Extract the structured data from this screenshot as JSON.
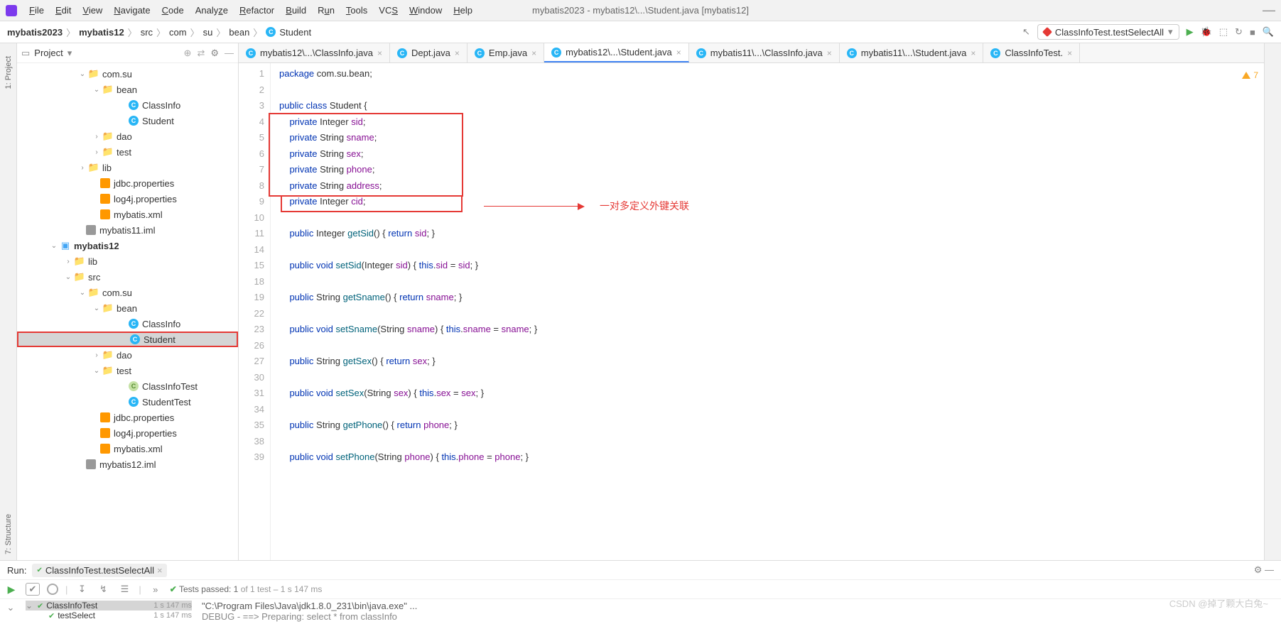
{
  "window_title": "mybatis2023 - mybatis12\\...\\Student.java [mybatis12]",
  "menu": [
    "File",
    "Edit",
    "View",
    "Navigate",
    "Code",
    "Analyze",
    "Refactor",
    "Build",
    "Run",
    "Tools",
    "VCS",
    "Window",
    "Help"
  ],
  "breadcrumb": [
    "mybatis2023",
    "mybatis12",
    "src",
    "com",
    "su",
    "bean",
    "Student"
  ],
  "run_config": "ClassInfoTest.testSelectAll",
  "project_label": "Project",
  "tree": [
    {
      "indent": 84,
      "arrow": "v",
      "icon": "folder",
      "label": "com.su"
    },
    {
      "indent": 104,
      "arrow": "v",
      "icon": "folder",
      "label": "bean"
    },
    {
      "indent": 140,
      "arrow": "",
      "icon": "c",
      "label": "ClassInfo"
    },
    {
      "indent": 140,
      "arrow": "",
      "icon": "c",
      "label": "Student"
    },
    {
      "indent": 104,
      "arrow": ">",
      "icon": "folder",
      "label": "dao"
    },
    {
      "indent": 104,
      "arrow": ">",
      "icon": "folder",
      "label": "test"
    },
    {
      "indent": 84,
      "arrow": ">",
      "icon": "folder",
      "label": "lib"
    },
    {
      "indent": 100,
      "arrow": "",
      "icon": "orange",
      "label": "jdbc.properties"
    },
    {
      "indent": 100,
      "arrow": "",
      "icon": "orange",
      "label": "log4j.properties"
    },
    {
      "indent": 100,
      "arrow": "",
      "icon": "orange",
      "label": "mybatis.xml"
    },
    {
      "indent": 80,
      "arrow": "",
      "icon": "gray",
      "label": "mybatis11.iml"
    },
    {
      "indent": 44,
      "arrow": "v",
      "icon": "module",
      "label": "mybatis12",
      "bold": true
    },
    {
      "indent": 64,
      "arrow": ">",
      "icon": "folder",
      "label": "lib"
    },
    {
      "indent": 64,
      "arrow": "v",
      "icon": "folder-blue",
      "label": "src"
    },
    {
      "indent": 84,
      "arrow": "v",
      "icon": "folder",
      "label": "com.su"
    },
    {
      "indent": 104,
      "arrow": "v",
      "icon": "folder",
      "label": "bean"
    },
    {
      "indent": 140,
      "arrow": "",
      "icon": "c",
      "label": "ClassInfo"
    },
    {
      "indent": 140,
      "arrow": "",
      "icon": "c",
      "label": "Student",
      "sel": true,
      "redbox": true
    },
    {
      "indent": 104,
      "arrow": ">",
      "icon": "folder",
      "label": "dao"
    },
    {
      "indent": 104,
      "arrow": "v",
      "icon": "folder",
      "label": "test"
    },
    {
      "indent": 140,
      "arrow": "",
      "icon": "cg",
      "label": "ClassInfoTest"
    },
    {
      "indent": 140,
      "arrow": "",
      "icon": "c",
      "label": "StudentTest"
    },
    {
      "indent": 100,
      "arrow": "",
      "icon": "orange",
      "label": "jdbc.properties"
    },
    {
      "indent": 100,
      "arrow": "",
      "icon": "orange",
      "label": "log4j.properties"
    },
    {
      "indent": 100,
      "arrow": "",
      "icon": "orange",
      "label": "mybatis.xml"
    },
    {
      "indent": 80,
      "arrow": "",
      "icon": "gray",
      "label": "mybatis12.iml"
    }
  ],
  "tabs": [
    {
      "label": "mybatis12\\...\\ClassInfo.java"
    },
    {
      "label": "Dept.java"
    },
    {
      "label": "Emp.java"
    },
    {
      "label": "mybatis12\\...\\Student.java",
      "active": true
    },
    {
      "label": "mybatis11\\...\\ClassInfo.java"
    },
    {
      "label": "mybatis11\\...\\Student.java"
    },
    {
      "label": "ClassInfoTest."
    }
  ],
  "lines": [
    "1",
    "2",
    "3",
    "4",
    "5",
    "6",
    "7",
    "8",
    "9",
    "10",
    "11",
    "14",
    "15",
    "18",
    "19",
    "22",
    "23",
    "26",
    "27",
    "30",
    "31",
    "34",
    "35",
    "38",
    "39"
  ],
  "code": "package com.su.bean;\n\npublic class Student {\n    private Integer sid;\n    private String sname;\n    private String sex;\n    private String phone;\n    private String address;\n    private Integer cid;\n\n    public Integer getSid() { return sid; }\n\n    public void setSid(Integer sid) { this.sid = sid; }\n\n    public String getSname() { return sname; }\n\n    public void setSname(String sname) { this.sname = sname; }\n\n    public String getSex() { return sex; }\n\n    public void setSex(String sex) { this.sex = sex; }\n\n    public String getPhone() { return phone; }\n\n    public void setPhone(String phone) { this.phone = phone; }",
  "annotation": "一对多定义外键关联",
  "warning_count": "7",
  "run_label": "Run:",
  "run_tab_label": "ClassInfoTest.testSelectAll",
  "tests_text": "Tests passed: 1",
  "tests_suffix": " of 1 test – 1 s 147 ms",
  "test_rows": [
    {
      "label": "ClassInfoTest",
      "time": "1 s 147 ms",
      "arrow": "v"
    },
    {
      "label": "testSelect",
      "time": "1 s 147 ms",
      "arrow": ""
    }
  ],
  "console_line1": "\"C:\\Program Files\\Java\\jdk1.8.0_231\\bin\\java.exe\" ...",
  "console_line2": "DEBUG - ==>  Preparing: select * from classInfo",
  "watermark": "CSDN @掉了颗大白兔~",
  "side_tabs": {
    "project": "1: Project",
    "structure": "7: Structure"
  }
}
